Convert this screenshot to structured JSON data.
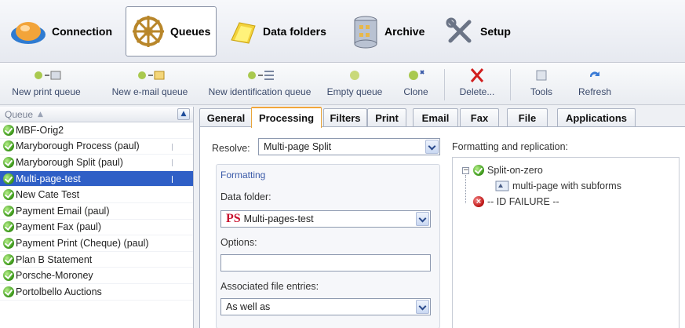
{
  "nav": {
    "items": [
      {
        "label": "Connection",
        "icon": "connection-icon"
      },
      {
        "label": "Queues",
        "icon": "queues-icon"
      },
      {
        "label": "Data folders",
        "icon": "data-folders-icon"
      },
      {
        "label": "Archive",
        "icon": "archive-icon"
      },
      {
        "label": "Setup",
        "icon": "setup-icon"
      }
    ],
    "active": "Queues"
  },
  "toolbar": {
    "buttons": [
      {
        "label": "New print queue",
        "icon": "new-print-queue-icon"
      },
      {
        "label": "New e-mail queue",
        "icon": "new-email-queue-icon"
      },
      {
        "label": "New identification queue",
        "icon": "new-identification-queue-icon"
      },
      {
        "label": "Empty queue",
        "icon": "empty-queue-icon"
      },
      {
        "label": "Clone",
        "icon": "clone-icon"
      },
      {
        "label": "Delete...",
        "icon": "delete-icon"
      },
      {
        "label": "Tools",
        "icon": "tools-icon"
      },
      {
        "label": "Refresh",
        "icon": "refresh-icon"
      }
    ]
  },
  "queue_list": {
    "header": "Queue",
    "items": [
      "MBF-Orig2",
      "Maryborough Process (paul)",
      "Maryborough Split (paul)",
      "Multi-page-test",
      "New Cate Test",
      "Payment Email (paul)",
      "Payment Fax (paul)",
      "Payment Print (Cheque) (paul)",
      "Plan B Statement",
      "Porsche-Moroney",
      "Portolbello Auctions"
    ],
    "selected": "Multi-page-test"
  },
  "tabs": {
    "items": [
      "General",
      "Processing",
      "Filters",
      "Print",
      "Email",
      "Fax",
      "File",
      "Applications"
    ],
    "active": "Processing"
  },
  "processing": {
    "resolve_label": "Resolve:",
    "resolve_value": "Multi-page Split",
    "formatting_title": "Formatting",
    "data_folder_label": "Data folder:",
    "data_folder_prefix": "PS",
    "data_folder_value": "Multi-pages-test",
    "options_label": "Options:",
    "options_value": "",
    "assoc_label": "Associated file entries:",
    "assoc_value": "As well as",
    "replication_label": "Formatting and replication:",
    "tree": {
      "root": "Split-on-zero",
      "child": "multi-page with subforms",
      "failure": "-- ID FAILURE --"
    }
  }
}
